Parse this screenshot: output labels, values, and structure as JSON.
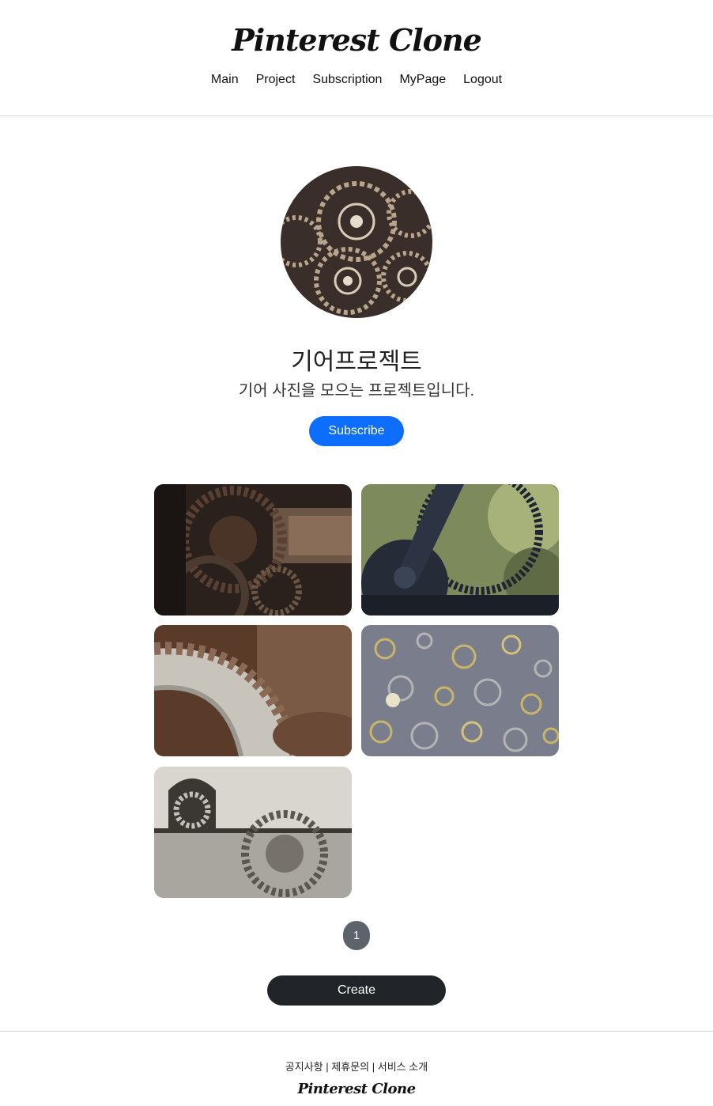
{
  "header": {
    "logo": "Pinterest Clone",
    "nav": [
      "Main",
      "Project",
      "Subscription",
      "MyPage",
      "Logout"
    ]
  },
  "project": {
    "title": "기어프로젝트",
    "description": "기어 사진을 모으는 프로젝트입니다.",
    "subscribe_label": "Subscribe"
  },
  "pagination": {
    "current": "1"
  },
  "actions": {
    "create_label": "Create"
  },
  "footer": {
    "links": [
      "공지사항",
      "제휴문의",
      "서비스 소개"
    ],
    "separator": "|",
    "logo": "Pinterest Clone"
  },
  "colors": {
    "primary": "#0d6efd",
    "dark": "#212529",
    "secondary": "#5c636a"
  }
}
